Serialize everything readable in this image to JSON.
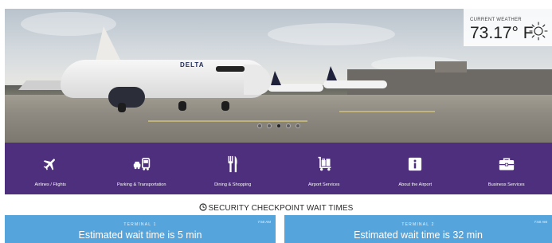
{
  "hero": {
    "plane_livery": "DELTA",
    "carousel": {
      "slide_count": 5,
      "active_index": 2
    }
  },
  "weather": {
    "label": "CURRENT WEATHER",
    "temperature": "73.17° F",
    "icon": "sun-icon"
  },
  "nav": {
    "background": "#4e2f7d",
    "items": [
      {
        "label": "Airlines / Flights",
        "icon": "airplane-icon"
      },
      {
        "label": "Parking & Transportation",
        "icon": "car-bus-icon"
      },
      {
        "label": "Dining & Shopping",
        "icon": "fork-knife-icon"
      },
      {
        "label": "Airport Services",
        "icon": "luggage-cart-icon"
      },
      {
        "label": "About the Airport",
        "icon": "info-icon"
      },
      {
        "label": "Business Services",
        "icon": "briefcase-icon"
      }
    ]
  },
  "security": {
    "title": "SECURITY CHECKPOINT WAIT TIMES",
    "icon": "clock-icon",
    "card_color": "#56a4dc",
    "terminals": [
      {
        "name": "TERMINAL 1",
        "updated": "7:50 AM",
        "wait": "Estimated wait time is 5 min"
      },
      {
        "name": "TERMINAL 2",
        "updated": "7:50 AM",
        "wait": "Estimated wait time is 32 min"
      }
    ]
  }
}
